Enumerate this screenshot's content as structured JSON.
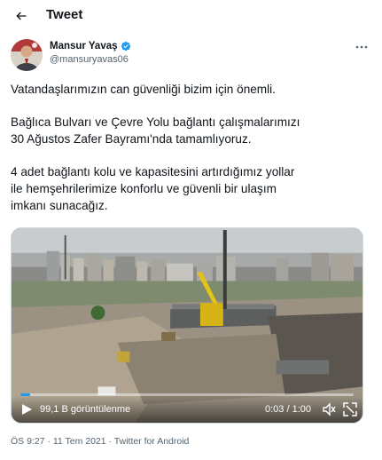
{
  "header": {
    "title": "Tweet",
    "back_icon": "arrow-left-icon"
  },
  "author": {
    "display_name": "Mansur Yavaş",
    "handle": "@mansuryavas06",
    "verified_icon": "verified-badge-icon",
    "more_icon": "more-horizontal-icon"
  },
  "tweet": {
    "paragraphs": [
      [
        "Vatandaşlarımızın can güvenliği bizim için önemli."
      ],
      [
        "Bağlıca Bulvarı ve Çevre Yolu bağlantı çalışmalarımızı",
        "30 Ağustos Zafer Bayramı'nda tamamlıyoruz."
      ],
      [
        "4 adet bağlantı kolu ve kapasitesini artırdığımız yollar",
        "ile hemşehrilerimize konforlu ve güvenli bir ulaşım",
        "imkanı sunacağız."
      ]
    ]
  },
  "video": {
    "views": "99,1 B görüntülenme",
    "time": "0:03 / 1:00",
    "progress": 0.03,
    "icons": [
      "play-icon",
      "volume-icon",
      "fullscreen-icon"
    ]
  },
  "meta": {
    "time": "ÖS 9:27",
    "separator1": " · ",
    "date": "11 Tem 2021",
    "separator2": " · ",
    "source": "Twitter for Android"
  },
  "colors": {
    "accent": "#1d9bf0",
    "text": "#0f1419",
    "secondary": "#536471"
  }
}
